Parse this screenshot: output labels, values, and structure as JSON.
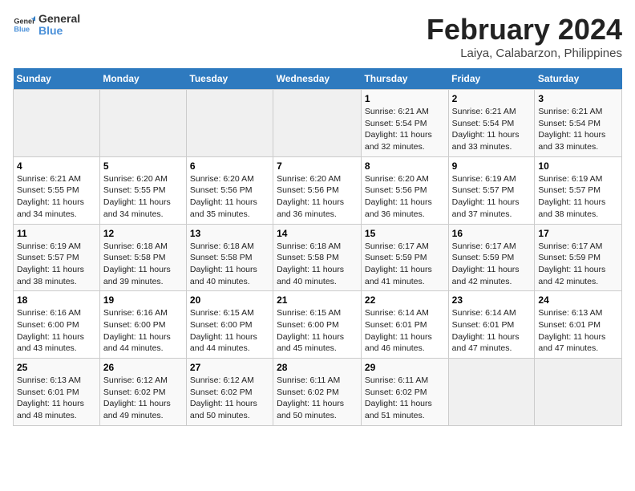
{
  "logo": {
    "line1": "General",
    "line2": "Blue"
  },
  "title": "February 2024",
  "subtitle": "Laiya, Calabarzon, Philippines",
  "days_of_week": [
    "Sunday",
    "Monday",
    "Tuesday",
    "Wednesday",
    "Thursday",
    "Friday",
    "Saturday"
  ],
  "weeks": [
    [
      {
        "day": "",
        "info": ""
      },
      {
        "day": "",
        "info": ""
      },
      {
        "day": "",
        "info": ""
      },
      {
        "day": "",
        "info": ""
      },
      {
        "day": "1",
        "info": "Sunrise: 6:21 AM\nSunset: 5:54 PM\nDaylight: 11 hours and 32 minutes."
      },
      {
        "day": "2",
        "info": "Sunrise: 6:21 AM\nSunset: 5:54 PM\nDaylight: 11 hours and 33 minutes."
      },
      {
        "day": "3",
        "info": "Sunrise: 6:21 AM\nSunset: 5:54 PM\nDaylight: 11 hours and 33 minutes."
      }
    ],
    [
      {
        "day": "4",
        "info": "Sunrise: 6:21 AM\nSunset: 5:55 PM\nDaylight: 11 hours and 34 minutes."
      },
      {
        "day": "5",
        "info": "Sunrise: 6:20 AM\nSunset: 5:55 PM\nDaylight: 11 hours and 34 minutes."
      },
      {
        "day": "6",
        "info": "Sunrise: 6:20 AM\nSunset: 5:56 PM\nDaylight: 11 hours and 35 minutes."
      },
      {
        "day": "7",
        "info": "Sunrise: 6:20 AM\nSunset: 5:56 PM\nDaylight: 11 hours and 36 minutes."
      },
      {
        "day": "8",
        "info": "Sunrise: 6:20 AM\nSunset: 5:56 PM\nDaylight: 11 hours and 36 minutes."
      },
      {
        "day": "9",
        "info": "Sunrise: 6:19 AM\nSunset: 5:57 PM\nDaylight: 11 hours and 37 minutes."
      },
      {
        "day": "10",
        "info": "Sunrise: 6:19 AM\nSunset: 5:57 PM\nDaylight: 11 hours and 38 minutes."
      }
    ],
    [
      {
        "day": "11",
        "info": "Sunrise: 6:19 AM\nSunset: 5:57 PM\nDaylight: 11 hours and 38 minutes."
      },
      {
        "day": "12",
        "info": "Sunrise: 6:18 AM\nSunset: 5:58 PM\nDaylight: 11 hours and 39 minutes."
      },
      {
        "day": "13",
        "info": "Sunrise: 6:18 AM\nSunset: 5:58 PM\nDaylight: 11 hours and 40 minutes."
      },
      {
        "day": "14",
        "info": "Sunrise: 6:18 AM\nSunset: 5:58 PM\nDaylight: 11 hours and 40 minutes."
      },
      {
        "day": "15",
        "info": "Sunrise: 6:17 AM\nSunset: 5:59 PM\nDaylight: 11 hours and 41 minutes."
      },
      {
        "day": "16",
        "info": "Sunrise: 6:17 AM\nSunset: 5:59 PM\nDaylight: 11 hours and 42 minutes."
      },
      {
        "day": "17",
        "info": "Sunrise: 6:17 AM\nSunset: 5:59 PM\nDaylight: 11 hours and 42 minutes."
      }
    ],
    [
      {
        "day": "18",
        "info": "Sunrise: 6:16 AM\nSunset: 6:00 PM\nDaylight: 11 hours and 43 minutes."
      },
      {
        "day": "19",
        "info": "Sunrise: 6:16 AM\nSunset: 6:00 PM\nDaylight: 11 hours and 44 minutes."
      },
      {
        "day": "20",
        "info": "Sunrise: 6:15 AM\nSunset: 6:00 PM\nDaylight: 11 hours and 44 minutes."
      },
      {
        "day": "21",
        "info": "Sunrise: 6:15 AM\nSunset: 6:00 PM\nDaylight: 11 hours and 45 minutes."
      },
      {
        "day": "22",
        "info": "Sunrise: 6:14 AM\nSunset: 6:01 PM\nDaylight: 11 hours and 46 minutes."
      },
      {
        "day": "23",
        "info": "Sunrise: 6:14 AM\nSunset: 6:01 PM\nDaylight: 11 hours and 47 minutes."
      },
      {
        "day": "24",
        "info": "Sunrise: 6:13 AM\nSunset: 6:01 PM\nDaylight: 11 hours and 47 minutes."
      }
    ],
    [
      {
        "day": "25",
        "info": "Sunrise: 6:13 AM\nSunset: 6:01 PM\nDaylight: 11 hours and 48 minutes."
      },
      {
        "day": "26",
        "info": "Sunrise: 6:12 AM\nSunset: 6:02 PM\nDaylight: 11 hours and 49 minutes."
      },
      {
        "day": "27",
        "info": "Sunrise: 6:12 AM\nSunset: 6:02 PM\nDaylight: 11 hours and 50 minutes."
      },
      {
        "day": "28",
        "info": "Sunrise: 6:11 AM\nSunset: 6:02 PM\nDaylight: 11 hours and 50 minutes."
      },
      {
        "day": "29",
        "info": "Sunrise: 6:11 AM\nSunset: 6:02 PM\nDaylight: 11 hours and 51 minutes."
      },
      {
        "day": "",
        "info": ""
      },
      {
        "day": "",
        "info": ""
      }
    ]
  ]
}
